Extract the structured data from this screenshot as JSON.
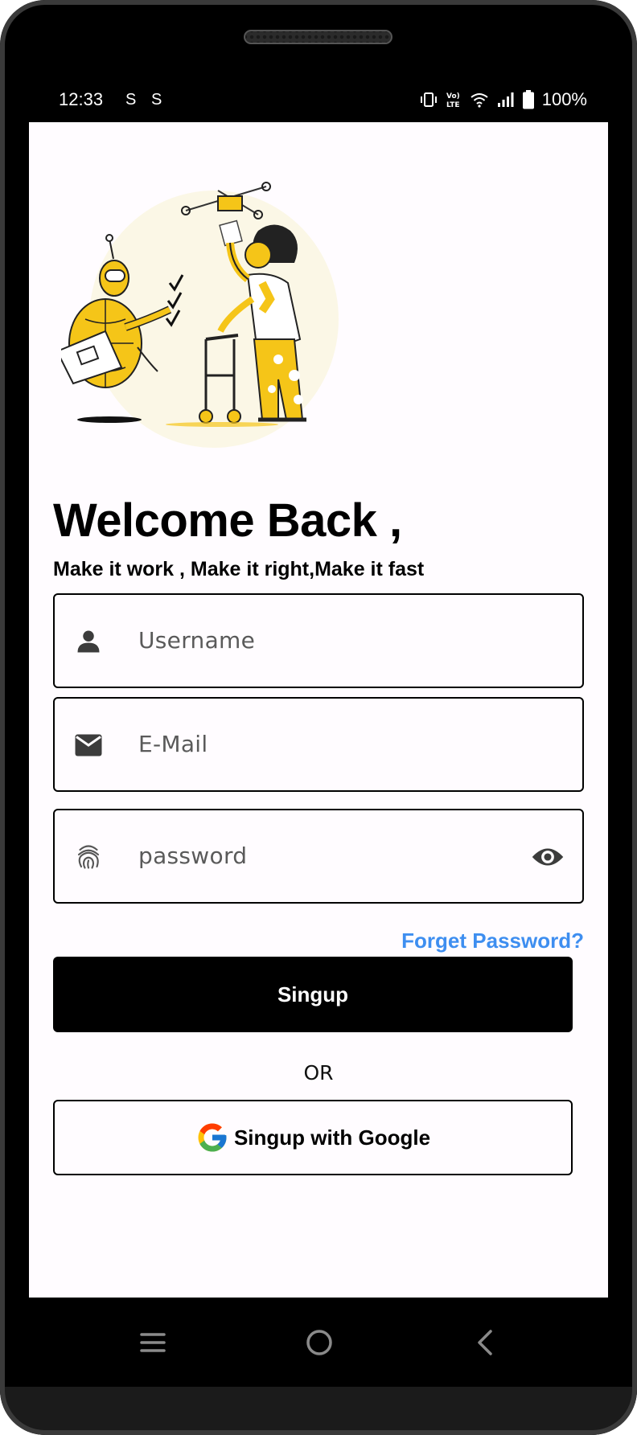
{
  "status_bar": {
    "time": "12:33",
    "notif_icon_1": "S",
    "notif_icon_2": "S",
    "battery": "100%"
  },
  "heading": {
    "title": "Welcome Back ,",
    "subtitle": "Make it work , Make it right,Make it fast"
  },
  "form": {
    "username_placeholder": "Username",
    "email_placeholder": "E-Mail",
    "password_placeholder": "password",
    "forgot_label": "Forget Password?"
  },
  "actions": {
    "signup_label": "Singup",
    "or_label": "OR",
    "google_label": "Singup with Google"
  },
  "colors": {
    "accent_link": "#3e8ef0",
    "primary_button": "#000000",
    "illustration_yellow": "#f5c518"
  },
  "icons": {
    "username": "person-icon",
    "email": "mail-icon",
    "password": "fingerprint-icon",
    "visibility": "eye-icon",
    "google": "google-logo",
    "nav_recent": "menu-icon",
    "nav_home": "home-circle-icon",
    "nav_back": "back-chevron-icon"
  }
}
